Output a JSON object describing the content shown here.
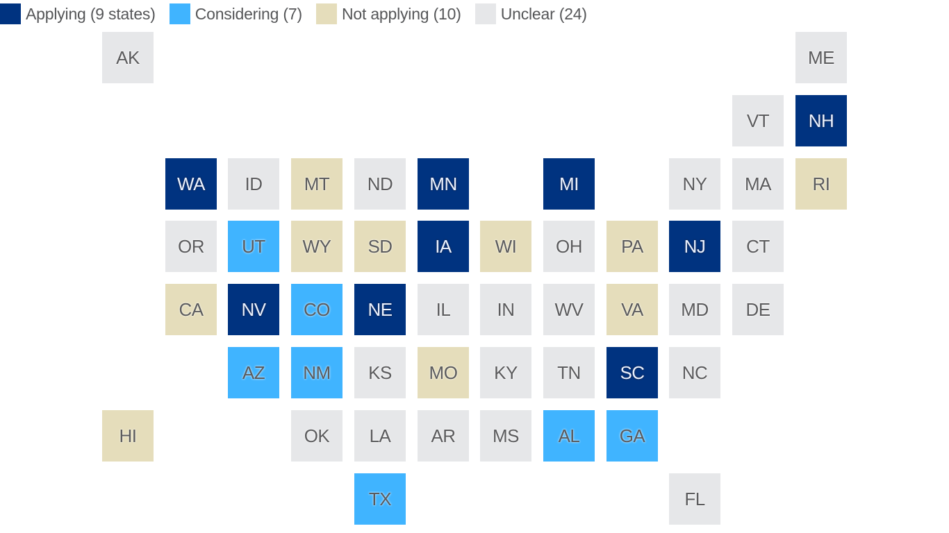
{
  "chart_data": {
    "type": "tile-grid-map",
    "title": "",
    "legend_placement": "top-left",
    "categories": [
      {
        "key": "applying",
        "label": "Applying (9 states)",
        "count": 9,
        "color": "#003380"
      },
      {
        "key": "considering",
        "label": "Considering (7)",
        "count": 7,
        "color": "#40B4FF"
      },
      {
        "key": "not_applying",
        "label": "Not applying (10)",
        "count": 10,
        "color": "#E5DDBB"
      },
      {
        "key": "unclear",
        "label": "Unclear (24)",
        "count": 24,
        "color": "#E6E7E9"
      }
    ],
    "states": [
      {
        "abbr": "AK",
        "row": 0,
        "col": 0,
        "status": "unclear"
      },
      {
        "abbr": "ME",
        "row": 0,
        "col": 11,
        "status": "unclear"
      },
      {
        "abbr": "VT",
        "row": 1,
        "col": 10,
        "status": "unclear"
      },
      {
        "abbr": "NH",
        "row": 1,
        "col": 11,
        "status": "applying"
      },
      {
        "abbr": "WA",
        "row": 2,
        "col": 1,
        "status": "applying"
      },
      {
        "abbr": "ID",
        "row": 2,
        "col": 2,
        "status": "unclear"
      },
      {
        "abbr": "MT",
        "row": 2,
        "col": 3,
        "status": "not_applying"
      },
      {
        "abbr": "ND",
        "row": 2,
        "col": 4,
        "status": "unclear"
      },
      {
        "abbr": "MN",
        "row": 2,
        "col": 5,
        "status": "applying"
      },
      {
        "abbr": "MI",
        "row": 2,
        "col": 7,
        "status": "applying"
      },
      {
        "abbr": "NY",
        "row": 2,
        "col": 9,
        "status": "unclear"
      },
      {
        "abbr": "MA",
        "row": 2,
        "col": 10,
        "status": "unclear"
      },
      {
        "abbr": "RI",
        "row": 2,
        "col": 11,
        "status": "not_applying"
      },
      {
        "abbr": "OR",
        "row": 3,
        "col": 1,
        "status": "unclear"
      },
      {
        "abbr": "UT",
        "row": 3,
        "col": 2,
        "status": "considering"
      },
      {
        "abbr": "WY",
        "row": 3,
        "col": 3,
        "status": "not_applying"
      },
      {
        "abbr": "SD",
        "row": 3,
        "col": 4,
        "status": "not_applying"
      },
      {
        "abbr": "IA",
        "row": 3,
        "col": 5,
        "status": "applying"
      },
      {
        "abbr": "WI",
        "row": 3,
        "col": 6,
        "status": "not_applying"
      },
      {
        "abbr": "OH",
        "row": 3,
        "col": 7,
        "status": "unclear"
      },
      {
        "abbr": "PA",
        "row": 3,
        "col": 8,
        "status": "not_applying"
      },
      {
        "abbr": "NJ",
        "row": 3,
        "col": 9,
        "status": "applying"
      },
      {
        "abbr": "CT",
        "row": 3,
        "col": 10,
        "status": "unclear"
      },
      {
        "abbr": "CA",
        "row": 4,
        "col": 1,
        "status": "not_applying"
      },
      {
        "abbr": "NV",
        "row": 4,
        "col": 2,
        "status": "applying"
      },
      {
        "abbr": "CO",
        "row": 4,
        "col": 3,
        "status": "considering"
      },
      {
        "abbr": "NE",
        "row": 4,
        "col": 4,
        "status": "applying"
      },
      {
        "abbr": "IL",
        "row": 4,
        "col": 5,
        "status": "unclear"
      },
      {
        "abbr": "IN",
        "row": 4,
        "col": 6,
        "status": "unclear"
      },
      {
        "abbr": "WV",
        "row": 4,
        "col": 7,
        "status": "unclear"
      },
      {
        "abbr": "VA",
        "row": 4,
        "col": 8,
        "status": "not_applying"
      },
      {
        "abbr": "MD",
        "row": 4,
        "col": 9,
        "status": "unclear"
      },
      {
        "abbr": "DE",
        "row": 4,
        "col": 10,
        "status": "unclear"
      },
      {
        "abbr": "AZ",
        "row": 5,
        "col": 2,
        "status": "considering"
      },
      {
        "abbr": "NM",
        "row": 5,
        "col": 3,
        "status": "considering"
      },
      {
        "abbr": "KS",
        "row": 5,
        "col": 4,
        "status": "unclear"
      },
      {
        "abbr": "MO",
        "row": 5,
        "col": 5,
        "status": "not_applying"
      },
      {
        "abbr": "KY",
        "row": 5,
        "col": 6,
        "status": "unclear"
      },
      {
        "abbr": "TN",
        "row": 5,
        "col": 7,
        "status": "unclear"
      },
      {
        "abbr": "SC",
        "row": 5,
        "col": 8,
        "status": "applying"
      },
      {
        "abbr": "NC",
        "row": 5,
        "col": 9,
        "status": "unclear"
      },
      {
        "abbr": "HI",
        "row": 6,
        "col": 0,
        "status": "not_applying"
      },
      {
        "abbr": "OK",
        "row": 6,
        "col": 3,
        "status": "unclear"
      },
      {
        "abbr": "LA",
        "row": 6,
        "col": 4,
        "status": "unclear"
      },
      {
        "abbr": "AR",
        "row": 6,
        "col": 5,
        "status": "unclear"
      },
      {
        "abbr": "MS",
        "row": 6,
        "col": 6,
        "status": "unclear"
      },
      {
        "abbr": "AL",
        "row": 6,
        "col": 7,
        "status": "considering"
      },
      {
        "abbr": "GA",
        "row": 6,
        "col": 8,
        "status": "considering"
      },
      {
        "abbr": "TX",
        "row": 7,
        "col": 4,
        "status": "considering"
      },
      {
        "abbr": "FL",
        "row": 7,
        "col": 9,
        "status": "unclear"
      }
    ]
  }
}
